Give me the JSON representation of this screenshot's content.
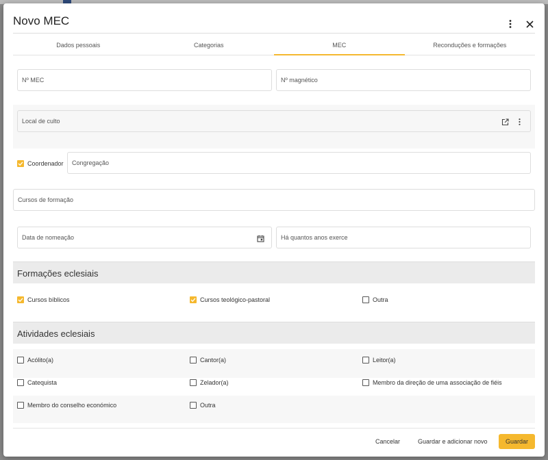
{
  "dialog": {
    "title": "Novo MEC",
    "more_icon": "more-vertical-icon",
    "close_icon": "close-icon"
  },
  "tabs": [
    {
      "label": "Dados pessoais",
      "active": false
    },
    {
      "label": "Categorias",
      "active": false
    },
    {
      "label": "MEC",
      "active": true
    },
    {
      "label": "Reconduções e formações",
      "active": false
    }
  ],
  "form": {
    "n_mec": {
      "placeholder": "Nº MEC",
      "value": ""
    },
    "n_magnetico": {
      "placeholder": "Nº magnético",
      "value": ""
    },
    "local_culto": {
      "placeholder": "Local de culto",
      "value": ""
    },
    "coordenador": {
      "label": "Coordenador",
      "checked": true
    },
    "congregacao": {
      "placeholder": "Congregação",
      "value": ""
    },
    "cursos_formacao": {
      "placeholder": "Cursos de formação",
      "value": ""
    },
    "data_nomeacao": {
      "placeholder": "Data de nomeação",
      "value": ""
    },
    "anos_exerce": {
      "placeholder": "Há quantos anos exerce",
      "value": ""
    }
  },
  "formacoes": {
    "title": "Formações eclesiais",
    "items": [
      {
        "label": "Cursos bíblicos",
        "checked": true
      },
      {
        "label": "Cursos teológico-pastoral",
        "checked": true
      },
      {
        "label": "Outra",
        "checked": false
      }
    ]
  },
  "atividades": {
    "title": "Atividades eclesiais",
    "items": [
      {
        "label": "Acólito(a)",
        "checked": false
      },
      {
        "label": "Cantor(a)",
        "checked": false
      },
      {
        "label": "Leitor(a)",
        "checked": false
      },
      {
        "label": "Catequista",
        "checked": false
      },
      {
        "label": "Zelador(a)",
        "checked": false
      },
      {
        "label": "Membro da direção de uma associação de fiéis",
        "checked": false
      },
      {
        "label": "Membro do conselho económico",
        "checked": false
      },
      {
        "label": "Outra",
        "checked": false
      }
    ]
  },
  "footer": {
    "cancel": "Cancelar",
    "save_new": "Guardar e adicionar novo",
    "save": "Guardar"
  },
  "colors": {
    "accent": "#f5b82e",
    "section_bg": "#ebebeb"
  }
}
